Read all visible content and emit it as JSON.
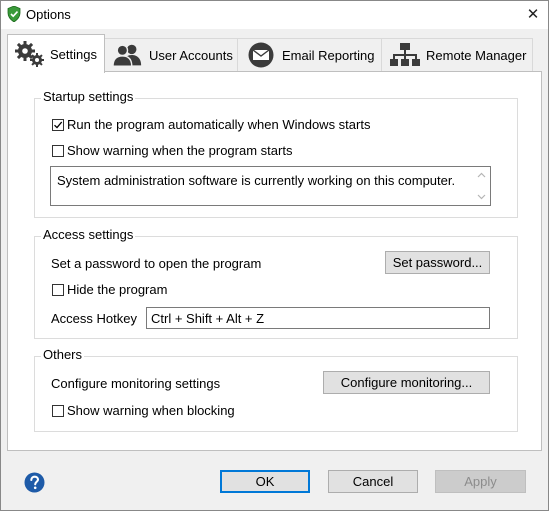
{
  "window": {
    "title": "Options",
    "close_glyph": "✕"
  },
  "tabs": [
    {
      "label": "Settings",
      "icon": "gears-icon",
      "active": true
    },
    {
      "label": "User Accounts",
      "icon": "users-icon",
      "active": false
    },
    {
      "label": "Email Reporting",
      "icon": "email-icon",
      "active": false
    },
    {
      "label": "Remote Manager",
      "icon": "network-icon",
      "active": false
    }
  ],
  "startup": {
    "title": "Startup settings",
    "run_on_startup": {
      "label": "Run the program automatically when Windows starts",
      "checked": true
    },
    "show_warning": {
      "label": "Show warning when the program starts",
      "checked": false
    },
    "warning_message": "System administration software is currently working on this computer."
  },
  "access": {
    "title": "Access settings",
    "password_label": "Set a password to open the program",
    "set_password_button": "Set password...",
    "hide_program": {
      "label": "Hide the program",
      "checked": false
    },
    "hotkey_label": "Access Hotkey",
    "hotkey_value": "Ctrl + Shift + Alt + Z"
  },
  "others": {
    "title": "Others",
    "monitoring_label": "Configure monitoring settings",
    "configure_button": "Configure monitoring...",
    "show_warning_blocking": {
      "label": "Show warning when blocking",
      "checked": false
    }
  },
  "footer": {
    "ok": "OK",
    "cancel": "Cancel",
    "apply": "Apply"
  },
  "colors": {
    "accent": "#0078d7",
    "help_blue": "#1e5ba8",
    "shield_green": "#3a9a3a"
  }
}
